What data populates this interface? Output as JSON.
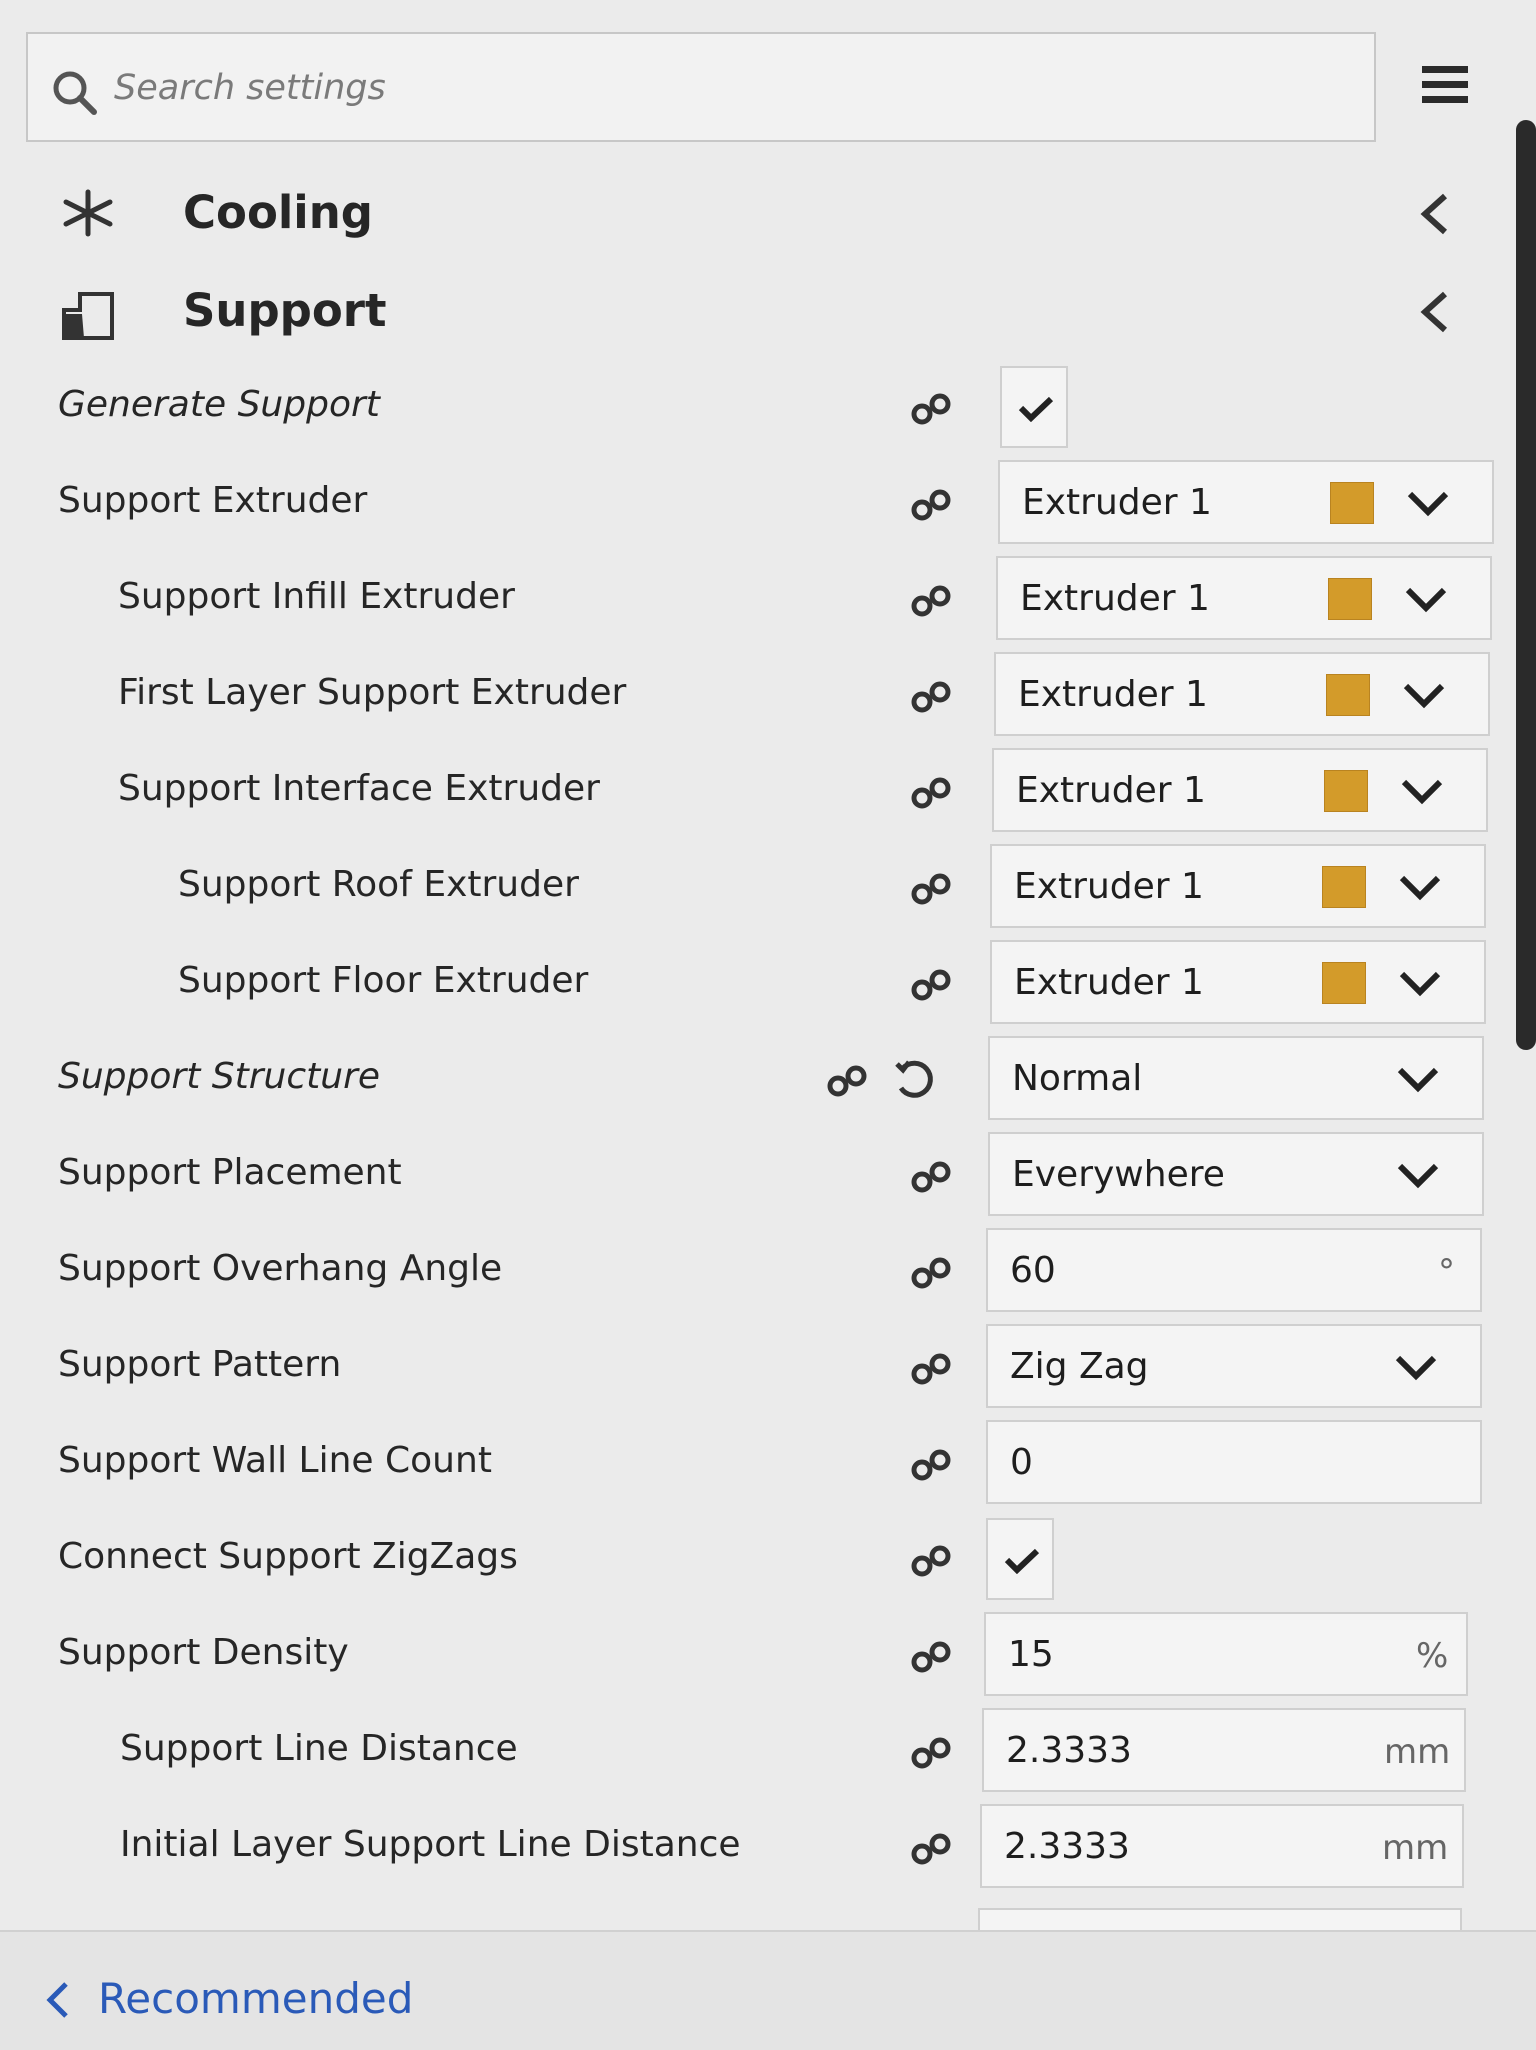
{
  "search": {
    "placeholder": "Search settings",
    "value": ""
  },
  "icons": {
    "search": "search-icon",
    "menu": "hamburger-menu-icon",
    "link": "link-icon",
    "reset": "reset-icon",
    "collapse": "chevron-left-icon",
    "dropdown": "chevron-down-icon"
  },
  "colors": {
    "extruder_swatch": "#d39b2a",
    "link_text": "#2a5ab8"
  },
  "categories": {
    "cooling": {
      "label": "Cooling",
      "icon": "fan-icon"
    },
    "support": {
      "label": "Support",
      "icon": "support-icon"
    }
  },
  "settings": [
    {
      "label": "Generate Support",
      "type": "checkbox",
      "checked": true
    },
    {
      "label": "Support Extruder",
      "type": "dropdown",
      "value": "Extruder 1"
    },
    {
      "label": "Support Infill Extruder",
      "type": "dropdown",
      "value": "Extruder 1"
    },
    {
      "label": "First Layer Support Extruder",
      "type": "dropdown",
      "value": "Extruder 1"
    },
    {
      "label": "Support Interface Extruder",
      "type": "dropdown",
      "value": "Extruder 1"
    },
    {
      "label": "Support Roof Extruder",
      "type": "dropdown",
      "value": "Extruder 1"
    },
    {
      "label": "Support Floor Extruder",
      "type": "dropdown",
      "value": "Extruder 1"
    },
    {
      "label": "Support Structure",
      "type": "dropdown",
      "value": "Normal"
    },
    {
      "label": "Support Placement",
      "type": "dropdown",
      "value": "Everywhere"
    },
    {
      "label": "Support Overhang Angle",
      "type": "number",
      "value": "60",
      "unit": "°"
    },
    {
      "label": "Support Pattern",
      "type": "dropdown",
      "value": "Zig Zag"
    },
    {
      "label": "Support Wall Line Count",
      "type": "number",
      "value": "0",
      "unit": ""
    },
    {
      "label": "Connect Support ZigZags",
      "type": "checkbox",
      "checked": true
    },
    {
      "label": "Support Density",
      "type": "number",
      "value": "15",
      "unit": "%"
    },
    {
      "label": "Support Line Distance",
      "type": "number",
      "value": "2.3333",
      "unit": "mm"
    },
    {
      "label": "Initial Layer Support Line Distance",
      "type": "number",
      "value": "2.3333",
      "unit": "mm"
    }
  ],
  "footer": {
    "back_label": "Recommended"
  }
}
